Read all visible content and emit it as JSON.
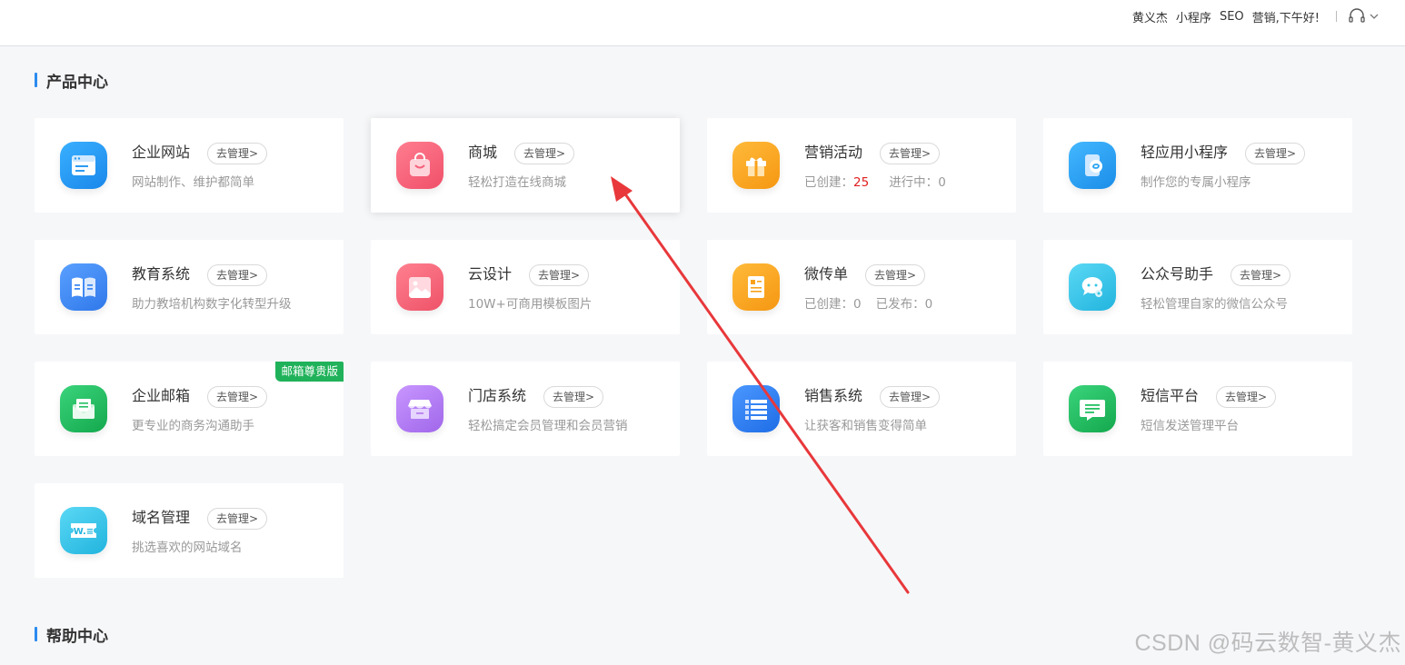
{
  "topbar": {
    "user_name": "黄义杰",
    "mini_program": "小程序",
    "seo": "SEO",
    "greeting": "营销,下午好!"
  },
  "sections": {
    "product_center": "产品中心",
    "help_center": "帮助中心"
  },
  "manage_label": "去管理>",
  "cards": {
    "website": {
      "name": "企业网站",
      "desc": "网站制作、维护都简单",
      "icon": "website-icon",
      "color": "#2b9bf4"
    },
    "mall": {
      "name": "商城",
      "desc": "轻松打造在线商城",
      "icon": "shopping-bag-icon",
      "color": "#f4607a"
    },
    "marketing": {
      "name": "营销活动",
      "created_label": "已创建：",
      "created_value": "25",
      "running_label": "进行中：",
      "running_value": "0",
      "icon": "gift-icon",
      "color": "#f8a21b"
    },
    "light_app": {
      "name": "轻应用小程序",
      "desc": "制作您的专属小程序",
      "icon": "mini-program-icon",
      "color": "#2aa5f3"
    },
    "education": {
      "name": "教育系统",
      "desc": "助力教培机构数字化转型升级",
      "icon": "book-icon",
      "color": "#3f8af0"
    },
    "cloud_design": {
      "name": "云设计",
      "desc": "10W+可商用模板图片",
      "icon": "image-icon",
      "color": "#f3697a"
    },
    "micro_flyer": {
      "name": "微传单",
      "created_label": "已创建：",
      "created_value": "0",
      "published_label": "已发布：",
      "published_value": "0",
      "icon": "flyer-icon",
      "color": "#f8a21b"
    },
    "wechat_assistant": {
      "name": "公众号助手",
      "desc": "轻松管理自家的微信公众号",
      "icon": "wechat-icon",
      "color": "#34c6e6"
    },
    "email": {
      "name": "企业邮箱",
      "desc": "更专业的商务沟通助手",
      "badge": "邮箱尊贵版",
      "icon": "mail-icon",
      "color": "#23c063"
    },
    "store": {
      "name": "门店系统",
      "desc": "轻松搞定会员管理和会员营销",
      "icon": "store-icon",
      "color": "#b77ff0"
    },
    "sales": {
      "name": "销售系统",
      "desc": "让获客和销售变得简单",
      "icon": "list-icon",
      "color": "#2f7ff0"
    },
    "sms": {
      "name": "短信平台",
      "desc": "短信发送管理平台",
      "icon": "message-icon",
      "color": "#23c063"
    },
    "domain": {
      "name": "域名管理",
      "desc": "挑选喜欢的网站域名",
      "icon": "domain-icon",
      "color": "#34c6e6"
    }
  },
  "watermark": "CSDN @码云数智-黄义杰",
  "annotation_color": "#e8383b"
}
